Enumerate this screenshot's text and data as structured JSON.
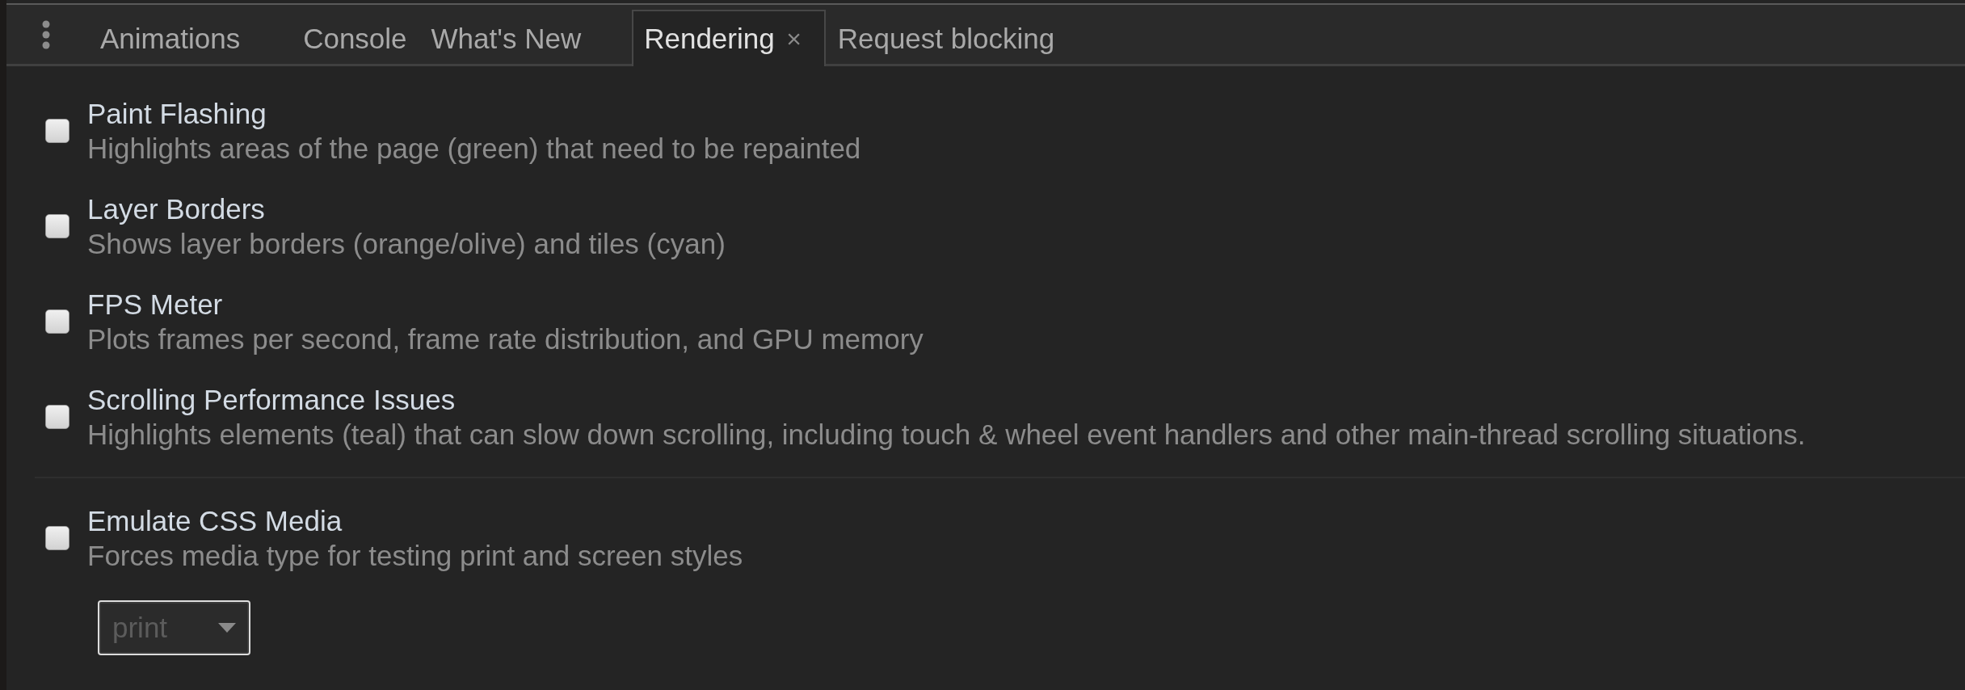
{
  "tabs": [
    {
      "label": "Animations",
      "selected": false,
      "closable": true
    },
    {
      "label": "Console",
      "selected": false,
      "closable": false
    },
    {
      "label": "What's New",
      "selected": false,
      "closable": true
    },
    {
      "label": "Rendering",
      "selected": true,
      "closable": true,
      "close": "×"
    },
    {
      "label": "Request blocking",
      "selected": false,
      "closable": true
    }
  ],
  "groups": [
    {
      "options": [
        {
          "title": "Paint Flashing",
          "description": "Highlights areas of the page (green) that need to be repainted",
          "checked": false
        },
        {
          "title": "Layer Borders",
          "description": "Shows layer borders (orange/olive) and tiles (cyan)",
          "checked": false
        },
        {
          "title": "FPS Meter",
          "description": "Plots frames per second, frame rate distribution, and GPU memory",
          "checked": false
        },
        {
          "title": "Scrolling Performance Issues",
          "description": "Highlights elements (teal) that can slow down scrolling, including touch & wheel event handlers and other main-thread scrolling situations.",
          "checked": false
        }
      ]
    },
    {
      "options": [
        {
          "title": "Emulate CSS Media",
          "description": "Forces media type for testing print and screen styles",
          "checked": false,
          "select": {
            "value": "print",
            "disabled": true
          }
        }
      ]
    }
  ]
}
